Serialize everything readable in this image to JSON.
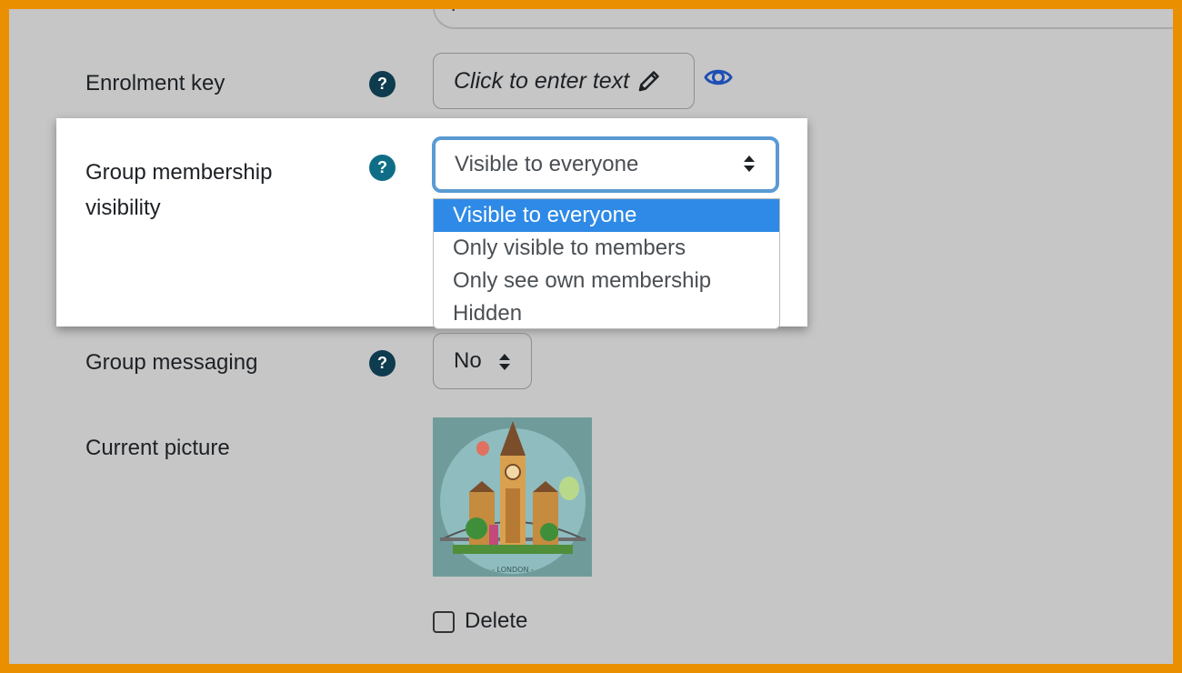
{
  "top_field": {
    "value": "p"
  },
  "enrolment_key": {
    "label": "Enrolment key",
    "inplace_text": "Click to enter text",
    "help_icon": "question-circle-icon",
    "edit_icon": "pencil-icon",
    "reveal_icon": "eye-icon"
  },
  "visibility": {
    "label_line1": "Group membership",
    "label_line2": "visibility",
    "selected": "Visible to everyone",
    "options": [
      "Visible to everyone",
      "Only visible to members",
      "Only see own membership",
      "Hidden"
    ],
    "help_icon": "question-circle-icon"
  },
  "messaging": {
    "label": "Group messaging",
    "selected": "No",
    "help_icon": "question-circle-icon"
  },
  "picture": {
    "label": "Current picture",
    "image_text": "- LONDON -",
    "delete_label": "Delete",
    "delete_checked": false
  },
  "colors": {
    "border": "#ea8f00",
    "background": "#c6c6c6",
    "help": "#0f3b4f",
    "focus": "#5a9bd4",
    "selected_option": "#2e8ae6",
    "eye": "#1f4fb5"
  }
}
